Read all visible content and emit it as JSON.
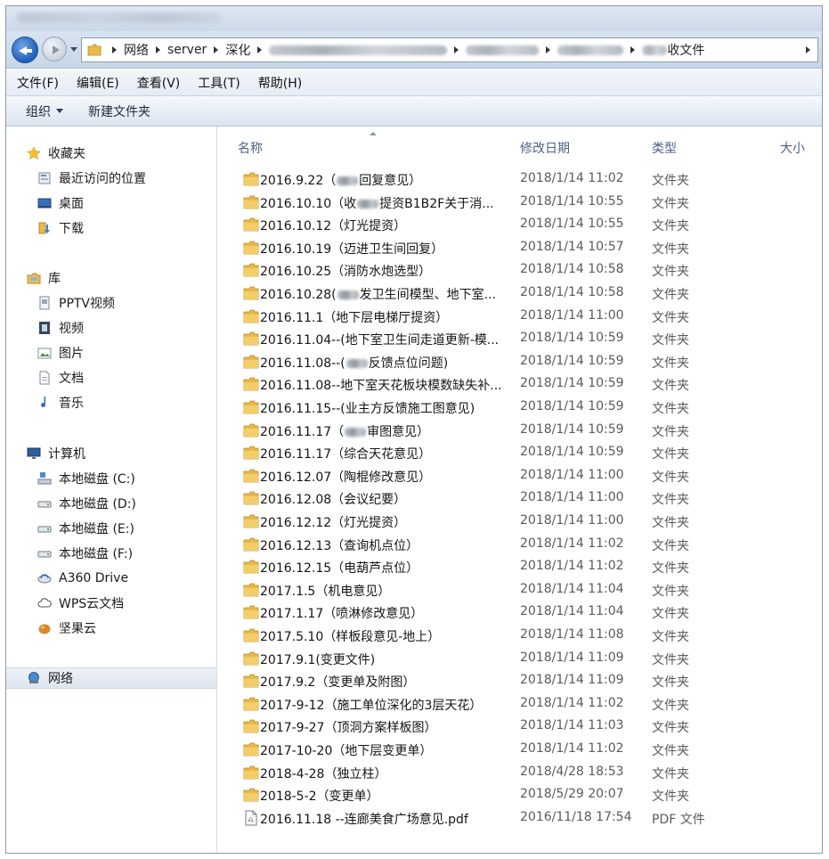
{
  "address": {
    "crumbs": [
      "网络",
      "server",
      "深化"
    ],
    "last_crumb": "收文件"
  },
  "menu": [
    "文件(F)",
    "编辑(E)",
    "查看(V)",
    "工具(T)",
    "帮助(H)"
  ],
  "commands": {
    "organize": "组织",
    "new_folder": "新建文件夹"
  },
  "nav": {
    "favorites": {
      "label": "收藏夹",
      "items": [
        "最近访问的位置",
        "桌面",
        "下载"
      ]
    },
    "libraries": {
      "label": "库",
      "items": [
        "PPTV视频",
        "视频",
        "图片",
        "文档",
        "音乐"
      ]
    },
    "computer": {
      "label": "计算机",
      "items": [
        "本地磁盘 (C:)",
        "本地磁盘 (D:)",
        "本地磁盘 (E:)",
        "本地磁盘 (F:)",
        "A360 Drive",
        "WPS云文档",
        "坚果云"
      ]
    },
    "network": {
      "label": "网络"
    }
  },
  "columns": {
    "name": "名称",
    "date": "修改日期",
    "type": "类型",
    "size": "大小"
  },
  "files": [
    {
      "pre": "2016.9.22（",
      "redact": true,
      "post": "回复意见）",
      "date": "2018/1/14 11:02",
      "type": "文件夹",
      "kind": "folder"
    },
    {
      "pre": "2016.10.10（收",
      "redact": true,
      "post": "提资B1B2F关于消...",
      "date": "2018/1/14 10:55",
      "type": "文件夹",
      "kind": "folder"
    },
    {
      "pre": "2016.10.12（灯光提资）",
      "redact": false,
      "post": "",
      "date": "2018/1/14 10:55",
      "type": "文件夹",
      "kind": "folder"
    },
    {
      "pre": "2016.10.19（迈进卫生间回复）",
      "redact": false,
      "post": "",
      "date": "2018/1/14 10:57",
      "type": "文件夹",
      "kind": "folder"
    },
    {
      "pre": "2016.10.25（消防水炮选型）",
      "redact": false,
      "post": "",
      "date": "2018/1/14 10:58",
      "type": "文件夹",
      "kind": "folder"
    },
    {
      "pre": "2016.10.28(",
      "redact": true,
      "post": "发卫生间模型、地下室...",
      "date": "2018/1/14 10:58",
      "type": "文件夹",
      "kind": "folder"
    },
    {
      "pre": "2016.11.1（地下层电梯厅提资）",
      "redact": false,
      "post": "",
      "date": "2018/1/14 11:00",
      "type": "文件夹",
      "kind": "folder"
    },
    {
      "pre": "2016.11.04--(地下室卫生间走道更新-模...",
      "redact": false,
      "post": "",
      "date": "2018/1/14 10:59",
      "type": "文件夹",
      "kind": "folder"
    },
    {
      "pre": "2016.11.08--(",
      "redact": true,
      "post": "反馈点位问题)",
      "date": "2018/1/14 10:59",
      "type": "文件夹",
      "kind": "folder"
    },
    {
      "pre": "2016.11.08--地下室天花板块模数缺失补...",
      "redact": false,
      "post": "",
      "date": "2018/1/14 10:59",
      "type": "文件夹",
      "kind": "folder"
    },
    {
      "pre": "2016.11.15--(业主方反馈施工图意见)",
      "redact": false,
      "post": "",
      "date": "2018/1/14 10:59",
      "type": "文件夹",
      "kind": "folder"
    },
    {
      "pre": "2016.11.17（",
      "redact": true,
      "post": "审图意见）",
      "date": "2018/1/14 10:59",
      "type": "文件夹",
      "kind": "folder"
    },
    {
      "pre": "2016.11.17（综合天花意见）",
      "redact": false,
      "post": "",
      "date": "2018/1/14 10:59",
      "type": "文件夹",
      "kind": "folder"
    },
    {
      "pre": "2016.12.07（陶棍修改意见）",
      "redact": false,
      "post": "",
      "date": "2018/1/14 11:00",
      "type": "文件夹",
      "kind": "folder"
    },
    {
      "pre": "2016.12.08（会议纪要）",
      "redact": false,
      "post": "",
      "date": "2018/1/14 11:00",
      "type": "文件夹",
      "kind": "folder"
    },
    {
      "pre": "2016.12.12（灯光提资）",
      "redact": false,
      "post": "",
      "date": "2018/1/14 11:00",
      "type": "文件夹",
      "kind": "folder"
    },
    {
      "pre": "2016.12.13（查询机点位）",
      "redact": false,
      "post": "",
      "date": "2018/1/14 11:02",
      "type": "文件夹",
      "kind": "folder"
    },
    {
      "pre": "2016.12.15（电葫芦点位）",
      "redact": false,
      "post": "",
      "date": "2018/1/14 11:02",
      "type": "文件夹",
      "kind": "folder"
    },
    {
      "pre": "2017.1.5（机电意见）",
      "redact": false,
      "post": "",
      "date": "2018/1/14 11:04",
      "type": "文件夹",
      "kind": "folder"
    },
    {
      "pre": "2017.1.17（喷淋修改意见）",
      "redact": false,
      "post": "",
      "date": "2018/1/14 11:04",
      "type": "文件夹",
      "kind": "folder"
    },
    {
      "pre": "2017.5.10（样板段意见-地上）",
      "redact": false,
      "post": "",
      "date": "2018/1/14 11:08",
      "type": "文件夹",
      "kind": "folder"
    },
    {
      "pre": "2017.9.1(变更文件)",
      "redact": false,
      "post": "",
      "date": "2018/1/14 11:09",
      "type": "文件夹",
      "kind": "folder"
    },
    {
      "pre": "2017.9.2（变更单及附图）",
      "redact": false,
      "post": "",
      "date": "2018/1/14 11:09",
      "type": "文件夹",
      "kind": "folder"
    },
    {
      "pre": "2017-9-12（施工单位深化的3层天花）",
      "redact": false,
      "post": "",
      "date": "2018/1/14 11:02",
      "type": "文件夹",
      "kind": "folder"
    },
    {
      "pre": "2017-9-27（顶洞方案样板图）",
      "redact": false,
      "post": "",
      "date": "2018/1/14 11:03",
      "type": "文件夹",
      "kind": "folder"
    },
    {
      "pre": "2017-10-20（地下层变更单）",
      "redact": false,
      "post": "",
      "date": "2018/1/14 11:02",
      "type": "文件夹",
      "kind": "folder"
    },
    {
      "pre": "2018-4-28（独立柱）",
      "redact": false,
      "post": "",
      "date": "2018/4/28 18:53",
      "type": "文件夹",
      "kind": "folder"
    },
    {
      "pre": "2018-5-2（变更单）",
      "redact": false,
      "post": "",
      "date": "2018/5/29 20:07",
      "type": "文件夹",
      "kind": "folder"
    },
    {
      "pre": "2016.11.18 --连廊美食广场意见.pdf",
      "redact": false,
      "post": "",
      "date": "2016/11/18 17:54",
      "type": "PDF 文件",
      "kind": "pdf"
    }
  ],
  "colors": {
    "accent": "#1f5fb8",
    "folder": "#e9b949",
    "header_text": "#4d6185"
  }
}
